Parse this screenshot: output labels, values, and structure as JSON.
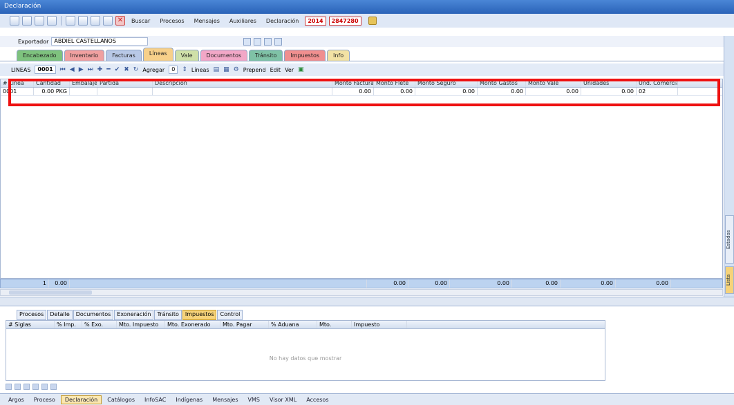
{
  "window": {
    "title": "Declaración"
  },
  "menu": {
    "items": [
      "Buscar",
      "Procesos",
      "Mensajes",
      "Auxiliares",
      "Declaración"
    ],
    "year": "2014",
    "number": "2847280"
  },
  "exporter": {
    "label": "Exportador",
    "value": "ABDIEL CASTELLANOS"
  },
  "tabs": [
    {
      "label": "Encabezado",
      "color": "#7ec27e"
    },
    {
      "label": "Inventario",
      "color": "#f0a0a0"
    },
    {
      "label": "Facturas",
      "color": "#b8c8e6"
    },
    {
      "label": "Líneas",
      "color": "#f7d08a"
    },
    {
      "label": "Vale",
      "color": "#cfe0a8"
    },
    {
      "label": "Documentos",
      "color": "#f2a7c7"
    },
    {
      "label": "Tránsito",
      "color": "#7fc2a6"
    },
    {
      "label": "Impuestos",
      "color": "#f08f8f"
    },
    {
      "label": "Info",
      "color": "#f2e2a4"
    }
  ],
  "lineas_bar": {
    "label": "LINEAS",
    "value": "0001",
    "agregar": "Agregar",
    "agregar_val": "0",
    "lineas": "Líneas",
    "prepend": "Prepend",
    "edit": "Edit",
    "ver": "Ver"
  },
  "grid": {
    "columns": [
      "# Línea",
      "Cantidad",
      "Embalaje",
      "Partida",
      "Descripción",
      "Monto Factura",
      "Monto Flete",
      "Monto Seguro",
      "Monto Gastos",
      "Monto Vale",
      "Unidades",
      "Und. Comercial"
    ],
    "rows": [
      [
        "0001",
        "0.00 PKG",
        "",
        "",
        "",
        "0.00",
        "0.00",
        "0.00",
        "0.00",
        "0.00",
        "0.00",
        "02"
      ]
    ],
    "footer": {
      "count": "1",
      "qty": "0.00",
      "factura": "0.00",
      "flete": "0.00",
      "seguro": "0.00",
      "gastos": "0.00",
      "vale": "0.00",
      "unidades": "0.00"
    }
  },
  "side_tabs": [
    "Estados",
    "Lista"
  ],
  "bottom_tabs": [
    "Procesos",
    "Detalle",
    "Documentos",
    "Exoneración",
    "Tránsito",
    "Impuestos",
    "Control"
  ],
  "bottom_grid": {
    "columns": [
      "# Siglas",
      "% Imp.",
      "% Exo.",
      "Mto. Impuesto",
      "Mto. Exonerado",
      "Mto. Pagar",
      "% Aduana",
      "Mto. Aduana",
      "Impuesto"
    ],
    "empty": "No hay datos que mostrar"
  },
  "bottom_bar": [
    "Argos",
    "Proceso",
    "Declaración",
    "Catálogos",
    "InfoSAC",
    "Indígenas",
    "Mensajes",
    "VMS",
    "Visor XML",
    "Accesos"
  ]
}
